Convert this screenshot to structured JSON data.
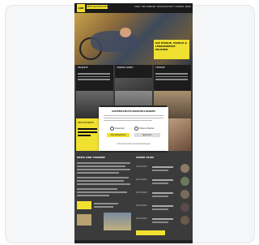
{
  "header": {
    "logo_text": "ARB",
    "brand_label": "SEHR NACHRICHTEN",
    "nav": [
      "START",
      "DER VERBAND",
      "MITGLIEDSCHAFT",
      "KONTAKT",
      "NEWS"
    ]
  },
  "hero": {
    "box_lines": [
      "DIE FAMILIE, FAMILIE &",
      "LEBENSWERTE",
      "ERLEBEN"
    ]
  },
  "columns": [
    {
      "label": "PROJEKTE"
    },
    {
      "label": "UNSERE ARBEIT"
    },
    {
      "label": "TERMINE"
    }
  ],
  "yellow_card": {
    "label": "NEUE PROJEKTE"
  },
  "modal": {
    "title": "DATENSCHUTZ-EINSTELLUNGEN",
    "option_1": "Essenziell",
    "option_2": "Externe Medien",
    "accept_label": "Alle akzeptieren",
    "save_label": "Speichern",
    "link_text": "Individuelle Datenschutzeinstellungen"
  },
  "lower": {
    "left_title": "NEWS UND TERMINE",
    "right_title": "UNSER TEAM",
    "events": [
      "12.03.2023",
      "18.03.2023",
      "24.03.2023",
      "02.04.2023",
      "15.04.2023"
    ]
  },
  "colors": {
    "accent": "#f0e030",
    "dark": "#1c1c1c",
    "page_bg": "#3a3a3a"
  }
}
